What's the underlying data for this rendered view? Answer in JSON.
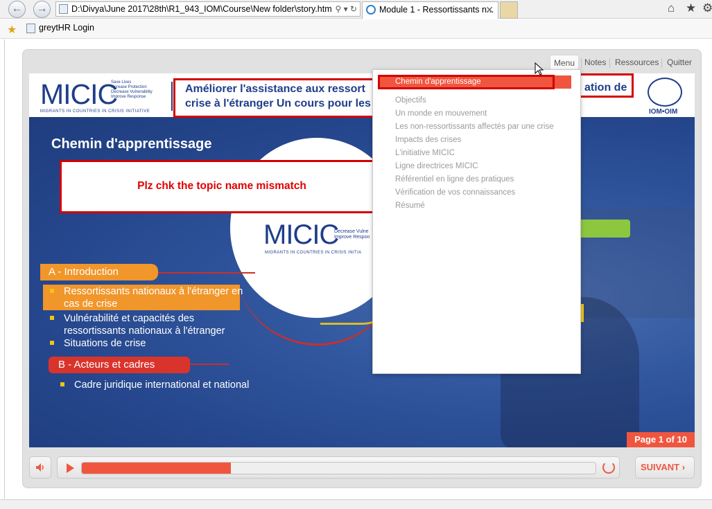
{
  "browser": {
    "address": "D:\\Divya\\June 2017\\28th\\R1_943_IOM\\Course\\New folder\\story.htm",
    "tab_title": "Module 1 - Ressortissants n...",
    "favorites": [
      "greytHR Login"
    ]
  },
  "player": {
    "nav": {
      "menu": "Menu",
      "notes": "Notes",
      "resources": "Ressources",
      "quit": "Quitter"
    },
    "next_label": "SUIVANT",
    "progress": 0.29
  },
  "slide": {
    "logo_word": "MICIC",
    "logo_taglines": [
      "Save Lives",
      "Increase Protection",
      "Decrease Vulnerability",
      "Improve Response"
    ],
    "logo_sub": "MIGRANTS IN COUNTRIES IN CRISIS INITIATIVE",
    "title_line1": "Améliorer l'assistance aux ressort",
    "title_line1_end": "ation de",
    "title_line2": "crise à l'étranger Un cours pour les",
    "iom_text": "IOM•OIM",
    "heading": "Chemin d'apprentissage",
    "section_a": "A - Introduction",
    "items_a": [
      "Ressortissants nationaux à l'étranger en cas de crise",
      "Vulnérabilité et capacités des ressortissants nationaux à l'étranger",
      "Situations de crise"
    ],
    "section_b": "B - Acteurs et cadres",
    "items_b": [
      "Cadre juridique international et national"
    ],
    "page_badge": "Page 1 of 10",
    "circle_word": "MICIC",
    "circle_tag": [
      "Decrease Vulne",
      "Improve Respon"
    ],
    "circle_sub": "MIGRANTS IN COUNTRIES IN CRISIS INITIA"
  },
  "annotation": {
    "text": "Plz chk the topic name mismatch"
  },
  "menu": {
    "items": [
      "Chemin d'apprentissage",
      "Objectifs",
      "Un monde en mouvement",
      "Les non-ressortissants affectés par une crise",
      "Impacts des crises",
      "L'initiative MICIC",
      "Ligne directrices MICIC",
      "Référentiel en ligne des pratiques",
      "Vérification de vos connaissances",
      "Résumé"
    ],
    "active_index": 0
  },
  "colors": {
    "accent": "#f0563f",
    "brand_blue": "#1f3d8a",
    "orange": "#f0962a",
    "red": "#d9342b",
    "annotation": "#d40000"
  }
}
